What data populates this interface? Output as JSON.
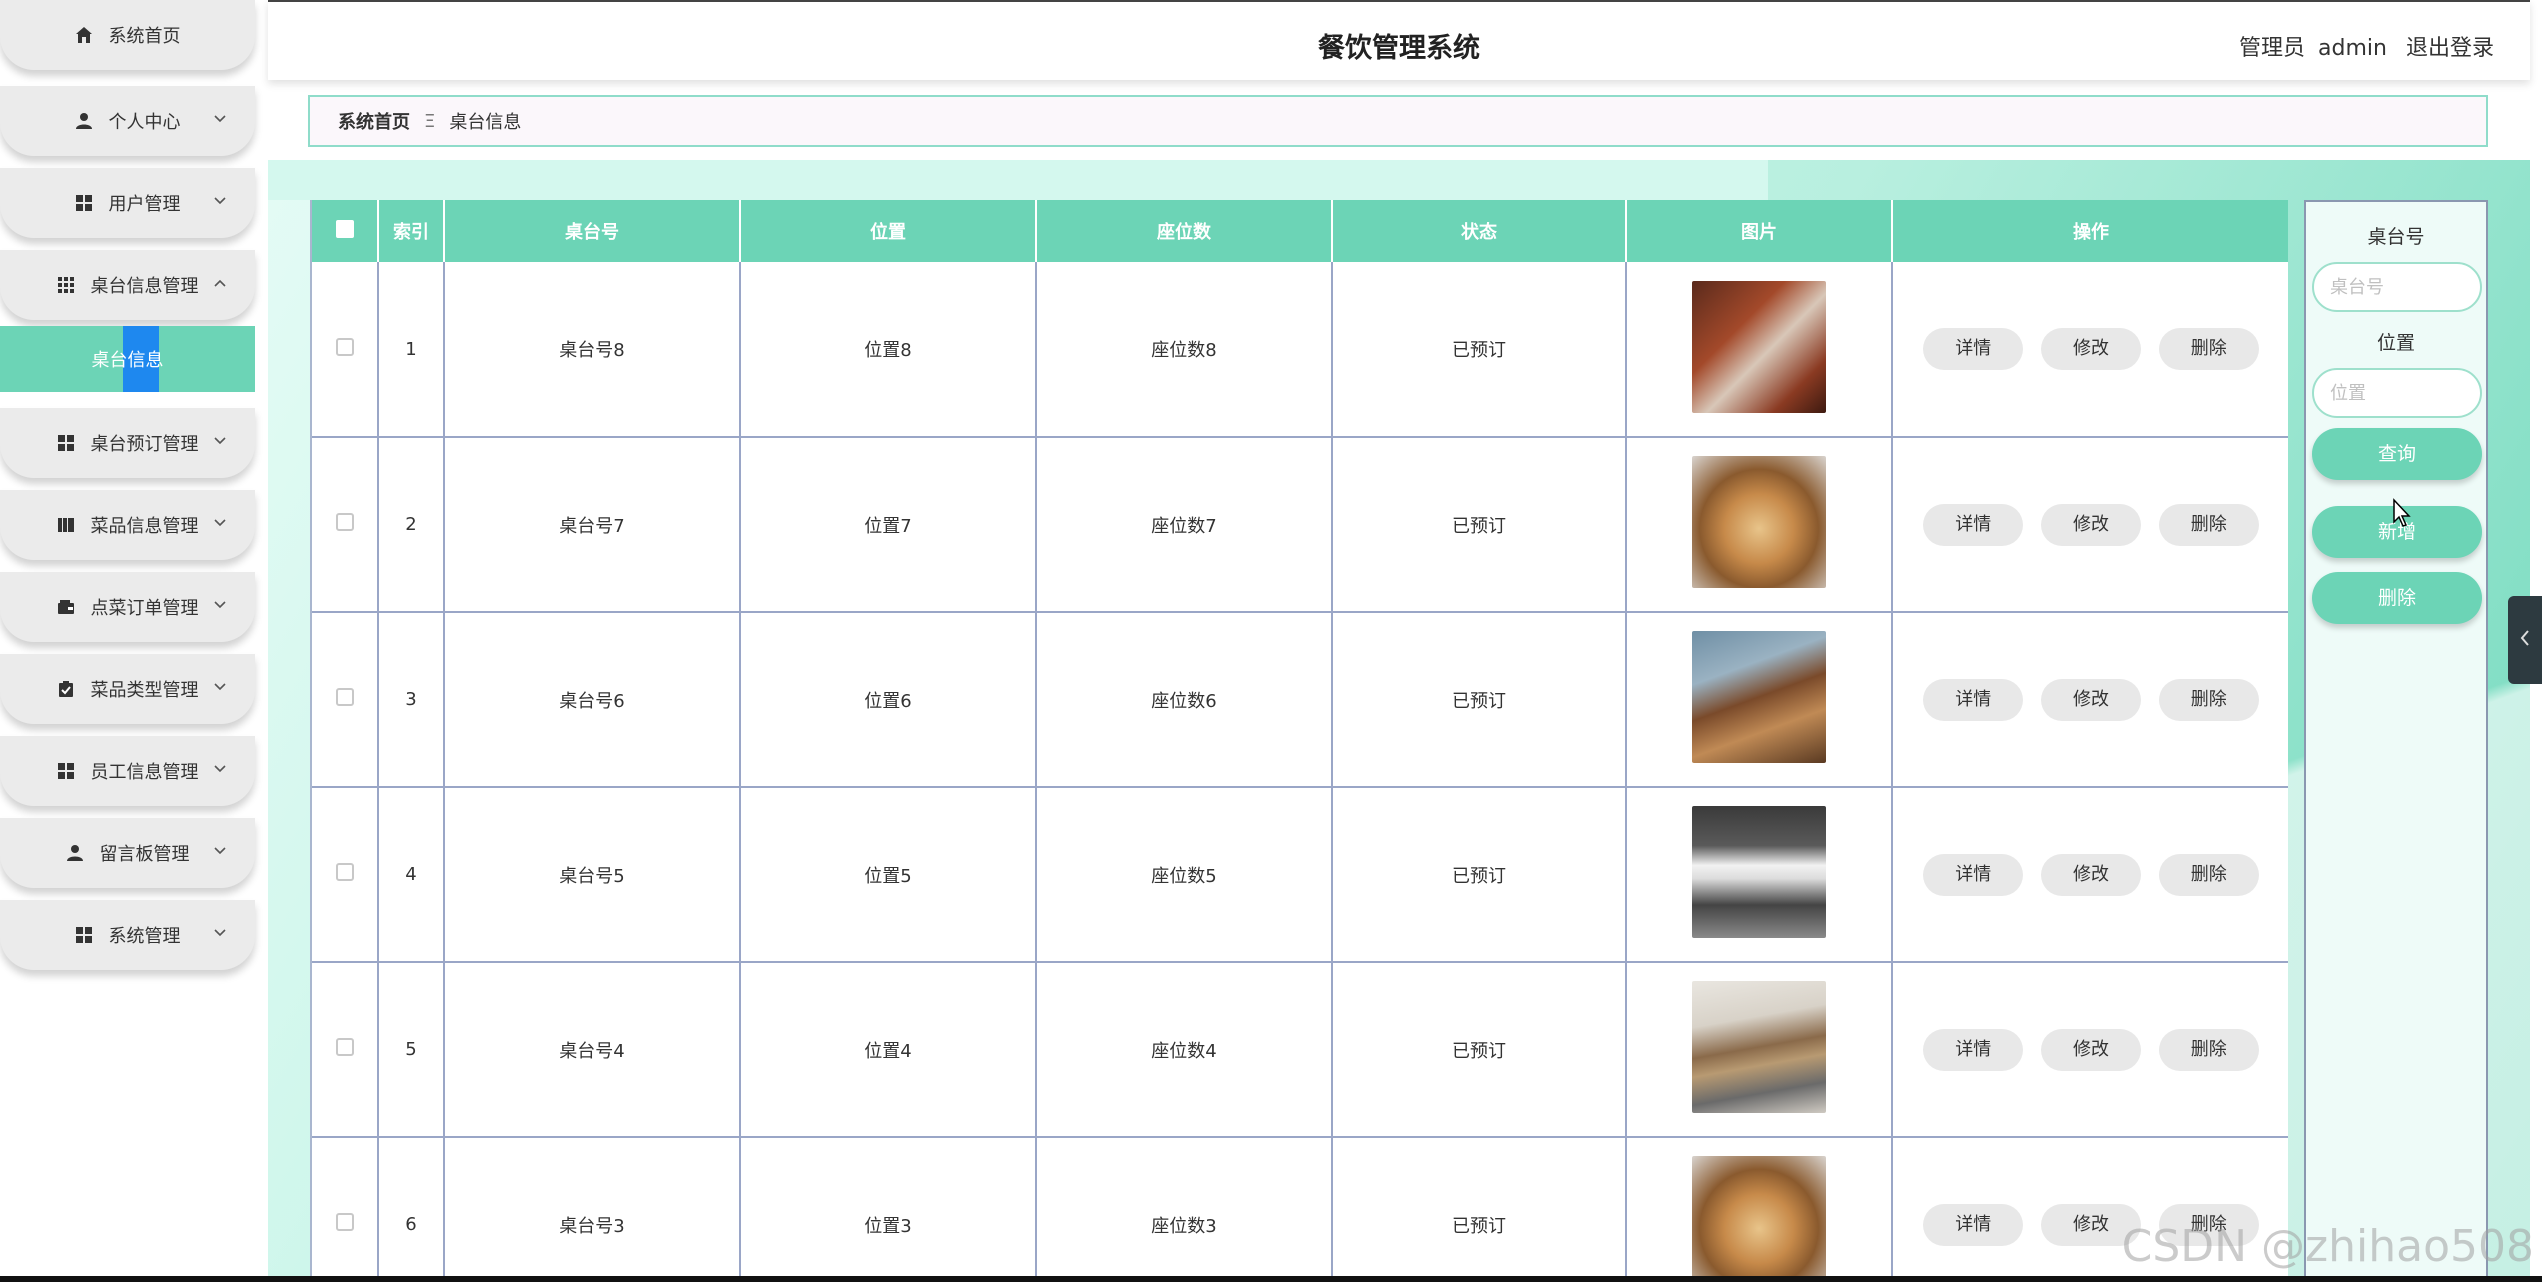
{
  "app_title": "餐饮管理系统",
  "user": {
    "role": "管理员",
    "name": "admin",
    "logout_label": "退出登录"
  },
  "sidebar": {
    "items": [
      {
        "label": "系统首页",
        "icon": "home-icon"
      },
      {
        "label": "个人中心",
        "icon": "person-icon"
      },
      {
        "label": "用户管理",
        "icon": "grid-icon"
      },
      {
        "label": "桌台信息管理",
        "icon": "grid9-icon"
      },
      {
        "label": "桌台预订管理",
        "icon": "grid-icon"
      },
      {
        "label": "菜品信息管理",
        "icon": "book-icon"
      },
      {
        "label": "点菜订单管理",
        "icon": "wallet-icon"
      },
      {
        "label": "菜品类型管理",
        "icon": "clipboard-icon"
      },
      {
        "label": "员工信息管理",
        "icon": "grid-icon"
      },
      {
        "label": "留言板管理",
        "icon": "person-icon"
      },
      {
        "label": "系统管理",
        "icon": "grid-icon"
      }
    ],
    "active_sub": "桌台信息"
  },
  "breadcrumb": {
    "home": "系统首页",
    "separator": "Ξ",
    "current": "桌台信息"
  },
  "table": {
    "columns": [
      "索引",
      "桌台号",
      "位置",
      "座位数",
      "状态",
      "图片",
      "操作"
    ],
    "rows": [
      {
        "index": "1",
        "table_no": "桌台号8",
        "location": "位置8",
        "seats": "座位数8",
        "status": "已预订"
      },
      {
        "index": "2",
        "table_no": "桌台号7",
        "location": "位置7",
        "seats": "座位数7",
        "status": "已预订"
      },
      {
        "index": "3",
        "table_no": "桌台号6",
        "location": "位置6",
        "seats": "座位数6",
        "status": "已预订"
      },
      {
        "index": "4",
        "table_no": "桌台号5",
        "location": "位置5",
        "seats": "座位数5",
        "status": "已预订"
      },
      {
        "index": "5",
        "table_no": "桌台号4",
        "location": "位置4",
        "seats": "座位数4",
        "status": "已预订"
      },
      {
        "index": "6",
        "table_no": "桌台号3",
        "location": "位置3",
        "seats": "座位数3",
        "status": "已预订"
      }
    ],
    "actions": {
      "detail": "详情",
      "edit": "修改",
      "delete": "删除"
    }
  },
  "search": {
    "table_no_label": "桌台号",
    "table_no_placeholder": "桌台号",
    "location_label": "位置",
    "location_placeholder": "位置",
    "query_button": "查询",
    "add_button": "新增",
    "delete_button": "删除"
  },
  "watermark": "CSDN @zhihao508",
  "colors": {
    "accent": "#6cd4b6",
    "selected": "#1e88ef"
  }
}
